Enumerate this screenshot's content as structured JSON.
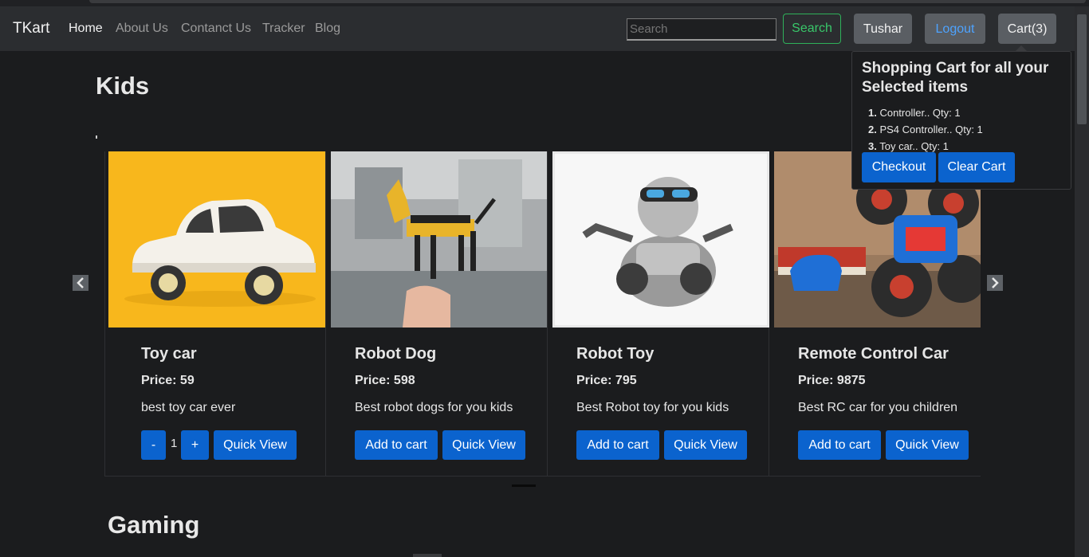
{
  "nav": {
    "brand": "TKart",
    "links": [
      "Home",
      "About Us",
      "Contanct Us",
      "Tracker",
      "Blog"
    ],
    "search_placeholder": "Search",
    "search_button": "Search",
    "user_button": "Tushar",
    "logout_button": "Logout",
    "cart_button": "Cart(3)"
  },
  "cart_popover": {
    "title": "Shopping Cart for all your Selected items",
    "items": [
      {
        "num": "1.",
        "text": " Controller.. Qty: 1"
      },
      {
        "num": "2.",
        "text": " PS4 Controller.. Qty: 1"
      },
      {
        "num": "3.",
        "text": " Toy car.. Qty: 1"
      }
    ],
    "checkout": "Checkout",
    "clear": "Clear Cart"
  },
  "sections": {
    "kids": "Kids",
    "gaming": "Gaming"
  },
  "products": [
    {
      "title": "Toy car",
      "price": "Price: 59",
      "desc": "best toy car ever",
      "qty": "1",
      "minus": "-",
      "plus": "+",
      "quick": "Quick View"
    },
    {
      "title": "Robot Dog",
      "price": "Price: 598",
      "desc": "Best robot dogs for you kids",
      "add": "Add to cart",
      "quick": "Quick View"
    },
    {
      "title": "Robot Toy",
      "price": "Price: 795",
      "desc": "Best Robot toy for you kids",
      "add": "Add to cart",
      "quick": "Quick View"
    },
    {
      "title": "Remote Control Car",
      "price": "Price: 9875",
      "desc": "Best RC car for you children",
      "add": "Add to cart",
      "quick": "Quick View"
    }
  ],
  "icons": {
    "prev": "chevron-left-icon",
    "next": "chevron-right-icon"
  },
  "colors": {
    "primary": "#0b63ce",
    "success": "#2fb15a",
    "navbar": "#2b2d30",
    "background": "#1b1c1e"
  }
}
